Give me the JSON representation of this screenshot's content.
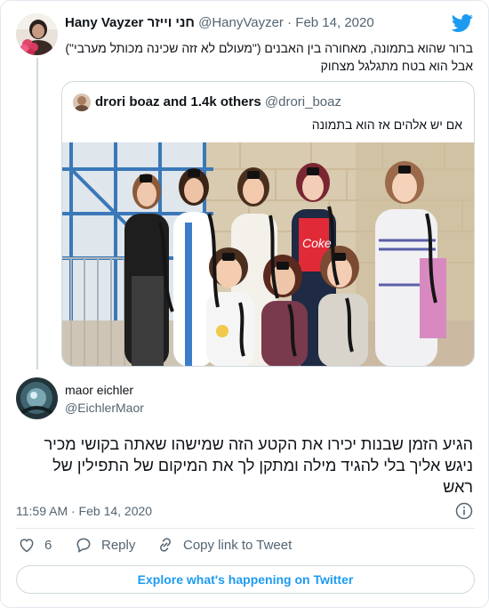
{
  "tweet": {
    "display_name": "Hany Vayzer חני וייזר",
    "handle": "@HanyVayzer",
    "date": "Feb 14, 2020",
    "text_line1": "ברור שהוא בתמונה, מאחורה בין האבנים (\"מעולם לא זזה שכינה מכותל מערבי\")",
    "text_line2": "אבל הוא בטח מתגלגל מצחוק"
  },
  "quoted": {
    "display_name": "drori boaz and 1.4k others",
    "handle": "@drori_boaz",
    "text": "אם יש אלהים אז הוא בתמונה",
    "photo_text": "Coke"
  },
  "reply": {
    "display_name": "maor eichler",
    "handle": "@EichlerMaor",
    "text_line1": "הגיע הזמן שבנות יכירו את הקטע הזה שמישהו שאתה בקושי מכיר",
    "text_line2": "ניגש אליך  בלי להגיד מילה ומתקן לך את המיקום של התפילין של",
    "text_line3": "ראש",
    "timestamp": "11:59 AM · Feb 14, 2020"
  },
  "actions": {
    "like_count": "6",
    "reply_label": "Reply",
    "copy_label": "Copy link to Tweet"
  },
  "explore_label": "Explore what's happening on Twitter",
  "colors": {
    "accent": "#1d9bf0",
    "muted": "#536471",
    "border": "#cfd9de"
  },
  "icons": [
    "twitter-bird-icon",
    "info-icon",
    "heart-icon",
    "reply-icon",
    "link-icon"
  ]
}
